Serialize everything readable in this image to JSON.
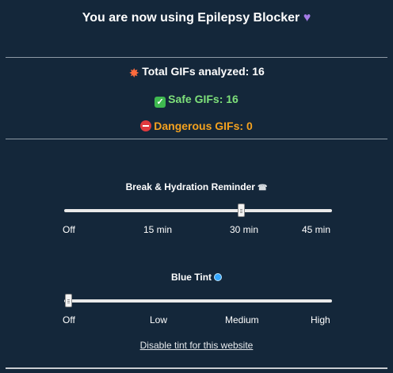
{
  "header": {
    "title": "You are now using Epilepsy Blocker",
    "heart_icon": "purple-heart-icon"
  },
  "stats": {
    "total": "Total GIFs analyzed: 16",
    "total_icon": "collision-icon",
    "safe": "Safe GIFs: 16",
    "safe_icon": "check-mark-icon",
    "dangerous": "Dangerous GIFs: 0",
    "dangerous_icon": "no-entry-icon"
  },
  "reminder": {
    "label": "Break & Hydration Reminder",
    "icon": "alarm-clock-icon",
    "options": [
      "Off",
      "15 min",
      "30 min",
      "45 min"
    ],
    "selected": "30 min",
    "level": 0.65
  },
  "tint": {
    "label": "Blue Tint",
    "icon": "droplet-icon",
    "options": [
      "Off",
      "Low",
      "Medium",
      "High"
    ],
    "selected": "Off",
    "level": 0.0,
    "disable_link": "Disable tint for this website"
  },
  "colors": {
    "background": "#14273a",
    "safe": "#7ee07a",
    "dangerous": "#f4a21f",
    "heart": "#a47be6"
  }
}
